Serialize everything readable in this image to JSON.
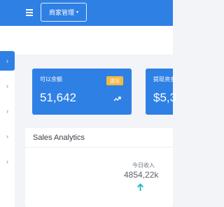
{
  "header": {
    "dropdown_label": "商家管理",
    "dropdown_caret": "▾"
  },
  "sidebar": {
    "items": [
      {
        "glyph": "›",
        "active": true
      },
      {
        "glyph": "›",
        "active": false
      },
      {
        "glyph": "›",
        "active": false
      },
      {
        "glyph": "›",
        "active": false
      },
      {
        "glyph": "›",
        "active": false
      }
    ]
  },
  "cards": [
    {
      "label": "可以余额",
      "value": "51,642",
      "badge": "提现",
      "icon": "trend-up-icon"
    },
    {
      "label": "提现资金",
      "value": "$5,3"
    }
  ],
  "sales": {
    "title": "Sales Analytics",
    "today_label": "今日收入",
    "today_value": "4854,22k",
    "trend_icon": "arrow-up-icon"
  },
  "colors": {
    "primary": "#2f80e4",
    "badge": "#f6b83f",
    "accent_arrow": "#1fb5c9"
  }
}
